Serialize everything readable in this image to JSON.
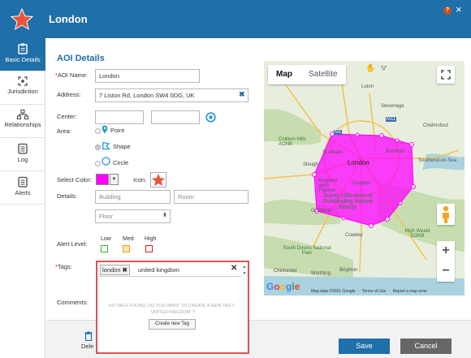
{
  "header": {
    "title": "London",
    "help_label": "?",
    "close_label": "×"
  },
  "sidebar": {
    "items": [
      {
        "label": "Basic Details"
      },
      {
        "label": "Jurisdiction"
      },
      {
        "label": "Relationships"
      },
      {
        "label": "Log"
      },
      {
        "label": "Alerts"
      }
    ]
  },
  "form": {
    "section_title": "AOI Details",
    "aoi_name_label": "AOI Name:",
    "aoi_name_value": "London",
    "address_label": "Address:",
    "address_value": "7 Liston Rd, London SW4 0DG, UK",
    "center_label": "Center:",
    "area_label": "Area:",
    "area_options": [
      "Point",
      "Shape",
      "Circle"
    ],
    "area_selected": "Shape",
    "select_color_label": "Select Color:",
    "selected_color": "#ff00ff",
    "icon_label": "Icon:",
    "details_label": "Details:",
    "building_placeholder": "Building",
    "room_placeholder": "Room",
    "floor_placeholder": "Floor",
    "alert_level_label": "Alert Level:",
    "alert_levels": [
      {
        "label": "Low",
        "color": "#2eb82e"
      },
      {
        "label": "Med",
        "color": "#f0a020"
      },
      {
        "label": "High",
        "color": "#d02020"
      }
    ],
    "tags_label": "Tags:",
    "comments_label": "Comments:"
  },
  "tags": {
    "chip": "london",
    "query": "united kingdom",
    "not_found": "NO TAGS FOUND, DO YOU WANT TO CREATE A NEW TAG? - 'UNITED KINGDOM' ?",
    "create_label": "Create new Tag"
  },
  "footer": {
    "delete_label": "Dele",
    "save_label": "Save",
    "cancel_label": "Cancel"
  },
  "map": {
    "tabs": [
      "Map",
      "Satellite"
    ],
    "active_tab": "Map",
    "polygon_color": "#ff00ff",
    "places": [
      "Luton",
      "Stevenage",
      "Chiltern Hills AONB",
      "M1",
      "M11",
      "Chelmsford",
      "St Albans",
      "Slough",
      "London",
      "Romford",
      "Southend-on-Sea",
      "Kingston upon Thames",
      "Croydon",
      "Surrey Hills Area of Outstanding Natural Beauty",
      "Guildford",
      "Crawley",
      "High Weald AONB",
      "South Downs National Park",
      "Worthing",
      "Brighton",
      "Chichester"
    ],
    "attribution": [
      "Map data ©2021 Google",
      "Terms of Use",
      "Report a map error"
    ],
    "logo": "Google",
    "zoom_in": "+",
    "zoom_out": "−"
  }
}
